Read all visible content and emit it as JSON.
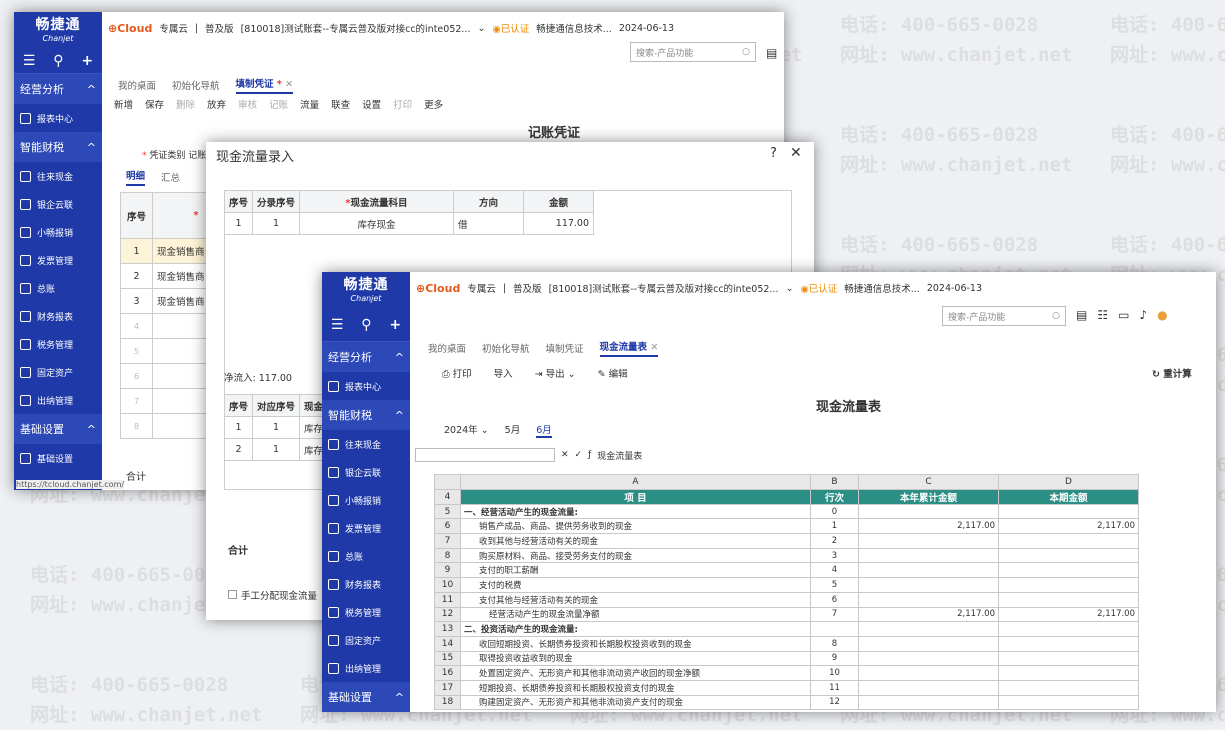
{
  "watermark": {
    "phone": "电话: 400-665-0028",
    "site": "网址: www.chanjet.net"
  },
  "brand": {
    "name_cn": "畅捷通",
    "name_en": "Chanjet",
    "cloud": "Cloud",
    "edition": "专属云",
    "version": "普及版",
    "account": "[810018]测试账套--专属云普及版对接cc的inte052...",
    "cert": "已认证",
    "company": "畅捷通信息技术...",
    "date": "2024-06-13",
    "search_placeholder": "搜索-产品功能"
  },
  "sidebar": {
    "sec1": "经营分析",
    "report_center": "报表中心",
    "sec2": "智能财税",
    "items": [
      "往来现金",
      "银企云联",
      "小畅报销",
      "发票管理",
      "总账",
      "财务报表",
      "税务管理",
      "固定资产",
      "出纳管理"
    ],
    "sec3": "基础设置",
    "basic_settings": "基础设置"
  },
  "win1": {
    "tabs": [
      "我的桌面",
      "初始化导航",
      "填制凭证"
    ],
    "toolbar": [
      "新增",
      "保存",
      "删除",
      "放弃",
      "审核",
      "记账",
      "流量",
      "联查",
      "设置",
      "打印",
      "更多"
    ],
    "title": "记账凭证",
    "voucher_type_label": "凭证类别",
    "voucher_type_value": "记账",
    "subtabs": [
      "明细",
      "汇总"
    ],
    "col_seq": "序号",
    "rows": [
      {
        "n": "1",
        "t": "现金销售商"
      },
      {
        "n": "2",
        "t": "现金销售商"
      },
      {
        "n": "3",
        "t": "现金销售商"
      },
      {
        "n": "4",
        "t": ""
      },
      {
        "n": "5",
        "t": ""
      },
      {
        "n": "6",
        "t": ""
      },
      {
        "n": "7",
        "t": ""
      },
      {
        "n": "8",
        "t": ""
      }
    ],
    "total": "合计",
    "status_url": "https://tcloud.chanjet.com/"
  },
  "dialog": {
    "title": "现金流量录入",
    "upper_headers": [
      "序号",
      "分录序号",
      "现金流量科目",
      "方向",
      "金额"
    ],
    "upper_row": [
      "1",
      "1",
      "库存现金",
      "借",
      "117.00"
    ],
    "net_label": "净流入:",
    "net_value": "117.00",
    "lower_headers": [
      "序号",
      "对应序号",
      "现金"
    ],
    "lower_rows": [
      [
        "1",
        "1",
        "库存"
      ],
      [
        "2",
        "1",
        "库存"
      ]
    ],
    "total": "合计",
    "manual": "手工分配现金流量"
  },
  "win2": {
    "tabs": [
      "我的桌面",
      "初始化导航",
      "填制凭证",
      "现金流量表"
    ],
    "toolbar": {
      "print": "打印",
      "import": "导入",
      "export": "导出",
      "edit": "编辑",
      "recalc": "重计算"
    },
    "report_title": "现金流量表",
    "year": "2024年",
    "months": [
      "5月",
      "6月"
    ],
    "formula": "现金流量表",
    "cols": [
      "A",
      "B",
      "C",
      "D"
    ],
    "headers": [
      "项  目",
      "行次",
      "本年累计金额",
      "本期金额"
    ],
    "rows": [
      {
        "r": "5",
        "a": "一、经营活动产生的现金流量:",
        "b": "0",
        "c": "",
        "d": "",
        "bold": true
      },
      {
        "r": "6",
        "a": "销售产成品、商品、提供劳务收到的现金",
        "b": "1",
        "c": "2,117.00",
        "d": "2,117.00"
      },
      {
        "r": "7",
        "a": "收到其他与经营活动有关的现金",
        "b": "2",
        "c": "",
        "d": ""
      },
      {
        "r": "8",
        "a": "购买原材料、商品、接受劳务支付的现金",
        "b": "3",
        "c": "",
        "d": ""
      },
      {
        "r": "9",
        "a": "支付的职工薪酬",
        "b": "4",
        "c": "",
        "d": ""
      },
      {
        "r": "10",
        "a": "支付的税费",
        "b": "5",
        "c": "",
        "d": ""
      },
      {
        "r": "11",
        "a": "支付其他与经营活动有关的现金",
        "b": "6",
        "c": "",
        "d": ""
      },
      {
        "r": "12",
        "a": "经营活动产生的现金流量净额",
        "b": "7",
        "c": "2,117.00",
        "d": "2,117.00",
        "indent": true
      },
      {
        "r": "13",
        "a": "二、投资活动产生的现金流量:",
        "b": "",
        "c": "",
        "d": "",
        "bold": true
      },
      {
        "r": "14",
        "a": "收回短期投资、长期债券投资和长期股权投资收到的现金",
        "b": "8",
        "c": "",
        "d": ""
      },
      {
        "r": "15",
        "a": "取得投资收益收到的现金",
        "b": "9",
        "c": "",
        "d": ""
      },
      {
        "r": "16",
        "a": "处置固定资产、无形资产和其他非流动资产收回的现金净额",
        "b": "10",
        "c": "",
        "d": ""
      },
      {
        "r": "17",
        "a": "短期投资、长期债券投资和长期股权投资支付的现金",
        "b": "11",
        "c": "",
        "d": ""
      },
      {
        "r": "18",
        "a": "购建固定资产、无形资产和其他非流动资产支付的现金",
        "b": "12",
        "c": "",
        "d": ""
      }
    ]
  }
}
